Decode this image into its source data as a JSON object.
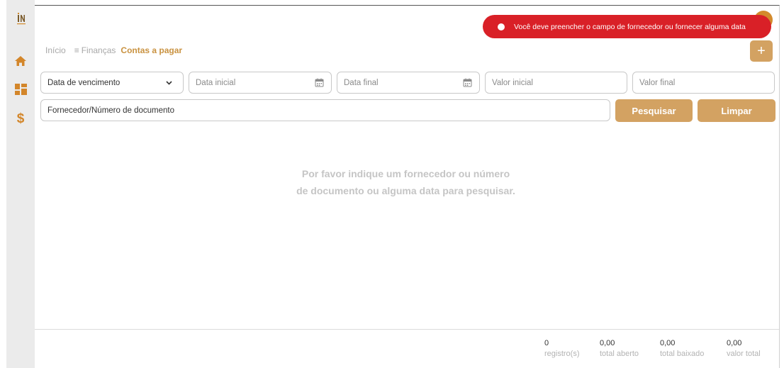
{
  "toast": {
    "message": "Você deve preencher o campo de fornecedor ou fornecer alguma data"
  },
  "breadcrumb": {
    "home": "Início",
    "section": "Finanças",
    "current": "Contas a pagar"
  },
  "header": {
    "add_label": "+"
  },
  "filters": {
    "date_type": "Data de vencimento",
    "start_date_placeholder": "Data inicial",
    "end_date_placeholder": "Data final",
    "min_value_placeholder": "Valor inicial",
    "max_value_placeholder": "Valor final",
    "search_placeholder": "Fornecedor/Número de documento"
  },
  "actions": {
    "search_label": "Pesquisar",
    "clear_label": "Limpar"
  },
  "empty_state": {
    "line1": "Por favor indique um fornecedor ou número",
    "line2": "de documento ou alguma data para pesquisar."
  },
  "summary": [
    {
      "value": "0",
      "label": "registro(s)"
    },
    {
      "value": "0,00",
      "label": "total aberto"
    },
    {
      "value": "0,00",
      "label": "total baixado"
    },
    {
      "value": "0,00",
      "label": "valor total"
    }
  ],
  "colors": {
    "accent": "#d3a262",
    "accent_text": "#c99240",
    "error": "#d92027",
    "sidebar_bg": "#ebebeb"
  },
  "icons": [
    "logo-icon",
    "home-icon",
    "dashboard-icon",
    "dollar-icon",
    "menu-icon",
    "chevron-down-icon",
    "calendar-icon",
    "plus-icon",
    "alert-icon"
  ]
}
